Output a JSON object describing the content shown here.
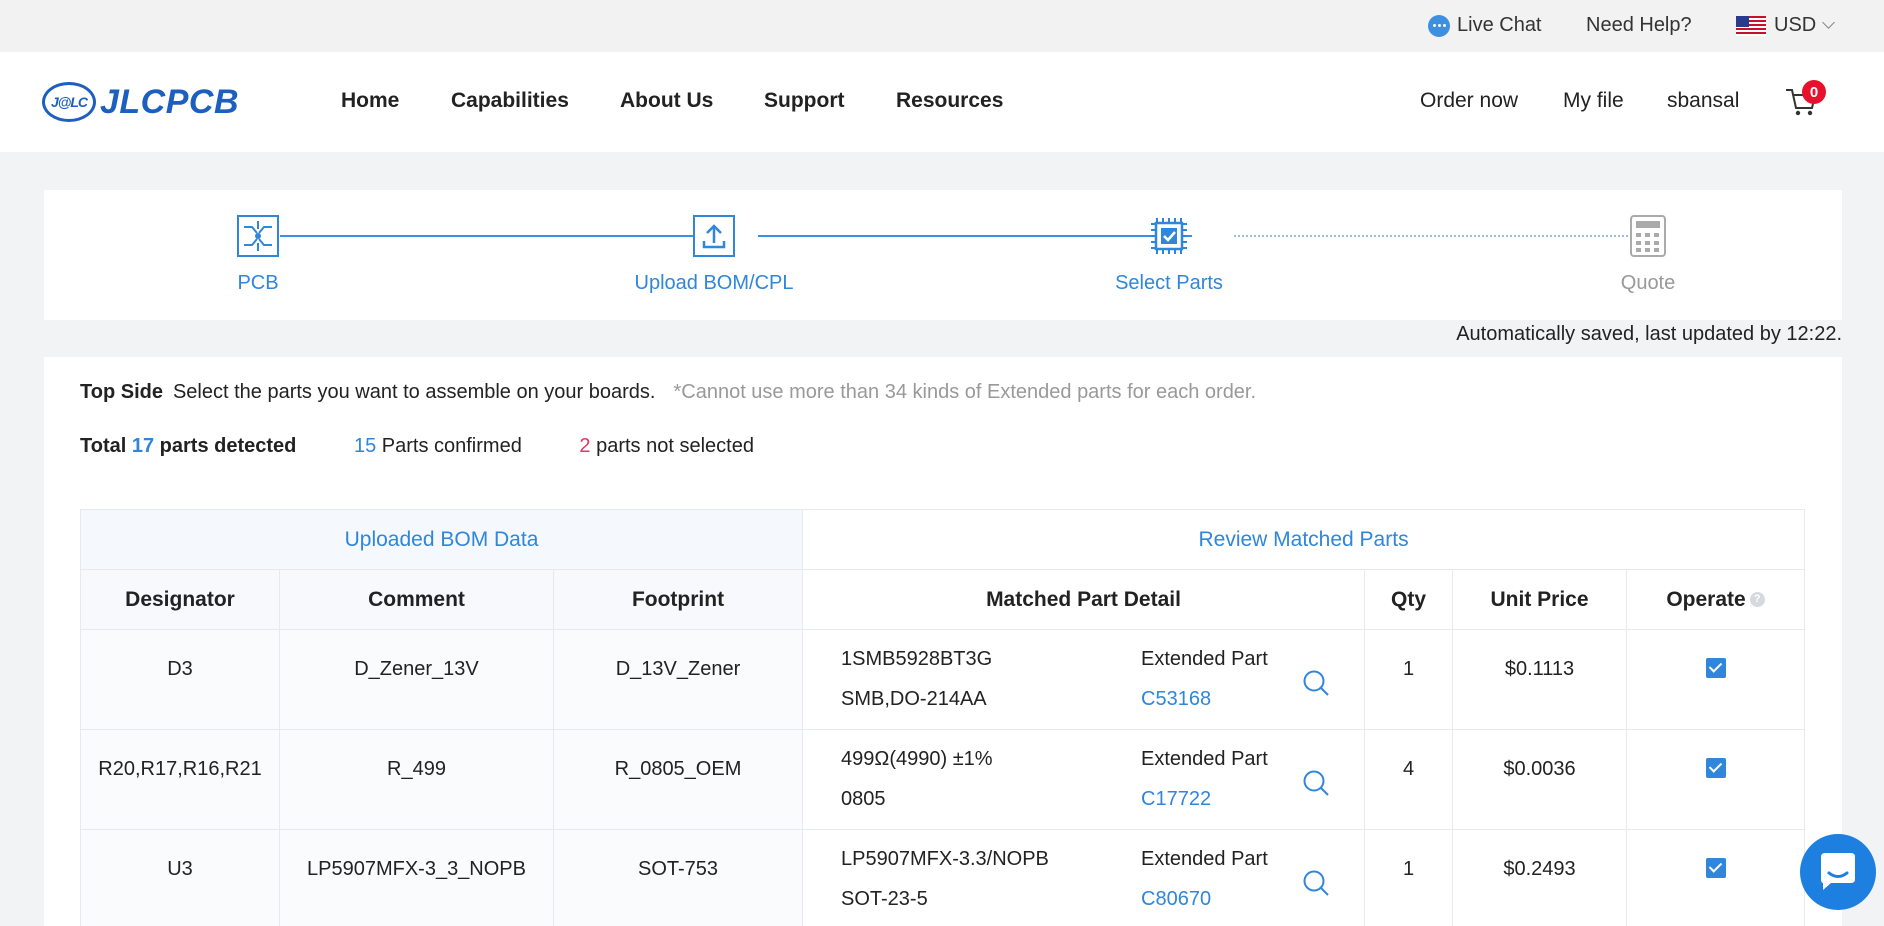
{
  "topbar": {
    "live_chat": "Live Chat",
    "need_help": "Need Help?",
    "currency": "USD"
  },
  "nav": {
    "logo_mark": "J@LC",
    "logo_text": "JLCPCB",
    "links": [
      "Home",
      "Capabilities",
      "About Us",
      "Support",
      "Resources"
    ],
    "order_now": "Order now",
    "my_file": "My file",
    "username": "sbansal",
    "cart_count": "0"
  },
  "steps": [
    {
      "label": "PCB",
      "state": "done",
      "icon": "pcb-icon"
    },
    {
      "label": "Upload BOM/CPL",
      "state": "done",
      "icon": "upload-icon"
    },
    {
      "label": "Select Parts",
      "state": "current",
      "icon": "chip-check-icon"
    },
    {
      "label": "Quote",
      "state": "pending",
      "icon": "calculator-icon"
    }
  ],
  "autosave": "Automatically saved, last updated by 12:22.",
  "summary": {
    "side_label": "Top Side",
    "instruction": "Select the parts you want to assemble on your boards.",
    "note": "*Cannot use more than 34 kinds of Extended parts for each order.",
    "total_prefix": "Total",
    "total_count": "17",
    "total_suffix": "parts detected",
    "confirmed_count": "15",
    "confirmed_label": "Parts confirmed",
    "not_selected_count": "2",
    "not_selected_label": "parts not selected"
  },
  "table": {
    "group_left": "Uploaded BOM Data",
    "group_right": "Review Matched Parts",
    "headers": [
      "Designator",
      "Comment",
      "Footprint",
      "Matched Part Detail",
      "Qty",
      "Unit Price",
      "Operate"
    ],
    "rows": [
      {
        "designator": "D3",
        "comment": "D_Zener_13V",
        "footprint": "D_13V_Zener",
        "part": "1SMB5928BT3G",
        "package": "SMB,DO-214AA",
        "type": "Extended Part",
        "code": "C53168",
        "qty": "1",
        "price": "$0.1113",
        "checked": true
      },
      {
        "designator": "R20,R17,R16,R21",
        "comment": "R_499",
        "footprint": "R_0805_OEM",
        "part": "499Ω(4990) ±1%",
        "package": "0805",
        "type": "Extended Part",
        "code": "C17722",
        "qty": "4",
        "price": "$0.0036",
        "checked": true
      },
      {
        "designator": "U3",
        "comment": "LP5907MFX-3_3_NOPB",
        "footprint": "SOT-753",
        "part": "LP5907MFX-3.3/NOPB",
        "package": "SOT-23-5",
        "type": "Extended Part",
        "code": "C80670",
        "qty": "1",
        "price": "$0.2493",
        "checked": true
      }
    ]
  },
  "colors": {
    "accent": "#2f86db",
    "alert": "#e8336b",
    "badge": "#e8112d"
  }
}
